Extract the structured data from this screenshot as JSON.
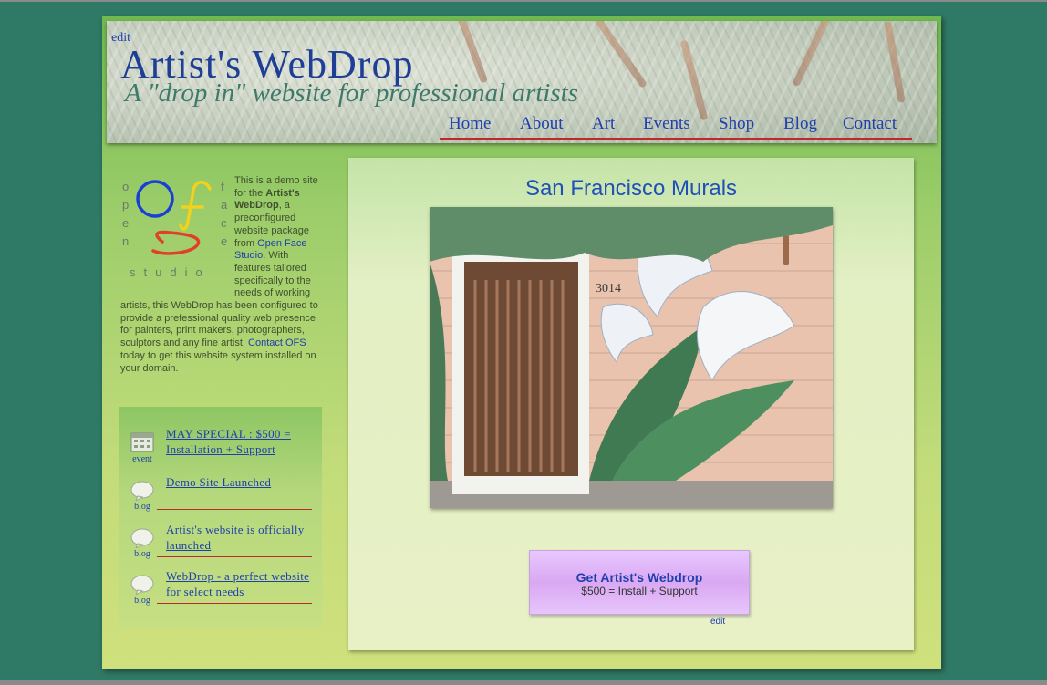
{
  "site": {
    "edit_label": "edit",
    "title": "Artist's WebDrop",
    "subtitle": "A \"drop in\" website for professional artists"
  },
  "nav": [
    "Home",
    "About",
    "Art",
    "Events",
    "Shop",
    "Blog",
    "Contact"
  ],
  "logo": {
    "left_letters": "open",
    "right_letters": "face",
    "bottom_text": "studio",
    "colors": {
      "circle_blue": "#1a3fd6",
      "f_yellow": "#f2d21c",
      "s_red": "#e0402a"
    }
  },
  "sidebar": {
    "intro_part1": "This is a demo site for the ",
    "intro_bold": "Artist's WebDrop",
    "intro_part2": ", a preconfigured website package from ",
    "intro_link1": "Open Face Studio",
    "intro_part3": ". With features tailored specifically to the needs of working artists, this WebDrop has been configured to provide a prefessional quality web presence for painters, print makers, photographers, sculptors and any fine artist. ",
    "intro_link2": "Contact OFS",
    "intro_part4": " today to get this website system installed on your domain."
  },
  "events": [
    {
      "kind": "event",
      "icon": "calendar-icon",
      "title": "MAY SPECIAL : $500 = Installation + Support"
    },
    {
      "kind": "blog",
      "icon": "speech-bubble-icon",
      "title": "Demo Site Launched"
    },
    {
      "kind": "blog",
      "icon": "speech-bubble-icon",
      "title": "Artist's website is officially launched"
    },
    {
      "kind": "blog",
      "icon": "speech-bubble-icon",
      "title": "WebDrop - a perfect website for select needs"
    }
  ],
  "main": {
    "title": "San Francisco Murals",
    "house_number": "3014",
    "cta_title": "Get Artist's Webdrop",
    "cta_sub": "$500 = Install + Support",
    "edit_label": "edit"
  },
  "colors": {
    "background": "#2f7a66",
    "link_blue": "#1f3fae",
    "nav_underline": "#c0282d",
    "cta_purple": "#e2bdfb"
  }
}
